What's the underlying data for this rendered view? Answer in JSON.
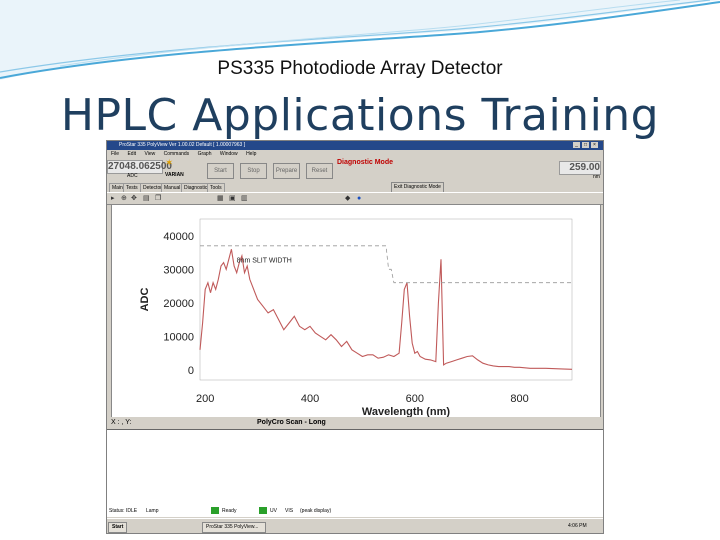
{
  "slide": {
    "subtitle": "PS335 Photodiode Array Detector",
    "title": "HPLC Applications Training",
    "accent": "#4aa8d8",
    "title_color": "#1f3f5f"
  },
  "app": {
    "window_title": "ProStar 335 PolyView Ver 1.00.02  Default  [ 1.00007963 ]",
    "menu": [
      "File",
      "Edit",
      "View",
      "Commands",
      "Graph",
      "Window",
      "Help"
    ],
    "readout_left": "27048.062500",
    "readout_left_unit": "ADC",
    "logo": "VARIAN",
    "buttons": [
      "Start",
      "Stop",
      "Prepare",
      "Reset"
    ],
    "mode": "Diagnostic Mode",
    "readout_right": "259.00",
    "readout_right_unit": "nm",
    "tabs": [
      "Main",
      "Tests",
      "Detector",
      "Manual",
      "Diagnostics",
      "Tools"
    ],
    "exit_button": "Exit Diagnostic Mode",
    "toolbar_icons": [
      "pointer-icon",
      "zoom-icon",
      "pan-icon",
      "print-icon",
      "copy-icon",
      "grid-icon",
      "overlay-icon",
      "scale-icon"
    ],
    "status_left": "X : , Y:",
    "status_center": "PolyCro Scan - Long",
    "taskbar": {
      "start": "Start",
      "task": "ProStar 335 PolyView...",
      "status_items": [
        "Status: IDLE",
        "Lamp",
        "Ready",
        "UV",
        "VIS",
        "(peak display)"
      ],
      "clock": "4:06 PM"
    }
  },
  "chart_data": {
    "type": "line",
    "title": "",
    "xlabel": "Wavelength (nm)",
    "ylabel": "ADC",
    "xlim": [
      190,
      900
    ],
    "ylim": [
      -3000,
      45000
    ],
    "xticks": [
      200,
      400,
      600,
      800
    ],
    "yticks": [
      0,
      10000,
      20000,
      30000,
      40000
    ],
    "annotation": "8nm SLIT WIDTH",
    "grid": false,
    "series": [
      {
        "color": "#c05a5a",
        "x": [
          190,
          195,
          200,
          205,
          210,
          215,
          220,
          225,
          230,
          235,
          240,
          245,
          250,
          255,
          260,
          265,
          270,
          275,
          280,
          285,
          290,
          300,
          310,
          320,
          330,
          340,
          350,
          360,
          370,
          380,
          390,
          400,
          410,
          420,
          430,
          440,
          450,
          460,
          470,
          480,
          490,
          500,
          510,
          520,
          530,
          540,
          550,
          560,
          570,
          575,
          580,
          585,
          590,
          595,
          600,
          605,
          610,
          620,
          630,
          640,
          645,
          650,
          655,
          660,
          670,
          680,
          690,
          700,
          710,
          720,
          730,
          740,
          750,
          760,
          770,
          780,
          790,
          800,
          820,
          850,
          880,
          900
        ],
        "y": [
          6000,
          14000,
          24000,
          26000,
          23000,
          26000,
          24000,
          27000,
          31000,
          32000,
          30000,
          33000,
          36000,
          31000,
          29000,
          32000,
          34000,
          29000,
          31000,
          27000,
          25000,
          21000,
          19000,
          17000,
          18000,
          15000,
          12000,
          14000,
          16000,
          13000,
          12000,
          13000,
          11000,
          10000,
          9000,
          10500,
          9000,
          7000,
          8500,
          6000,
          5000,
          4000,
          4500,
          4500,
          3500,
          3800,
          4500,
          4000,
          5000,
          14000,
          24000,
          26000,
          16000,
          8000,
          5000,
          5500,
          4000,
          3200,
          3000,
          2500,
          20000,
          33000,
          1500,
          2000,
          2500,
          3000,
          3500,
          4000,
          4200,
          3000,
          2000,
          1500,
          1200,
          1000,
          1000,
          1000,
          800,
          800,
          500,
          500,
          300,
          200
        ]
      },
      {
        "color": "#999999",
        "dashed": true,
        "x": [
          190,
          545,
          550,
          555,
          560,
          900
        ],
        "y": [
          37000,
          37000,
          30000,
          30000,
          26000,
          26000
        ]
      }
    ]
  }
}
